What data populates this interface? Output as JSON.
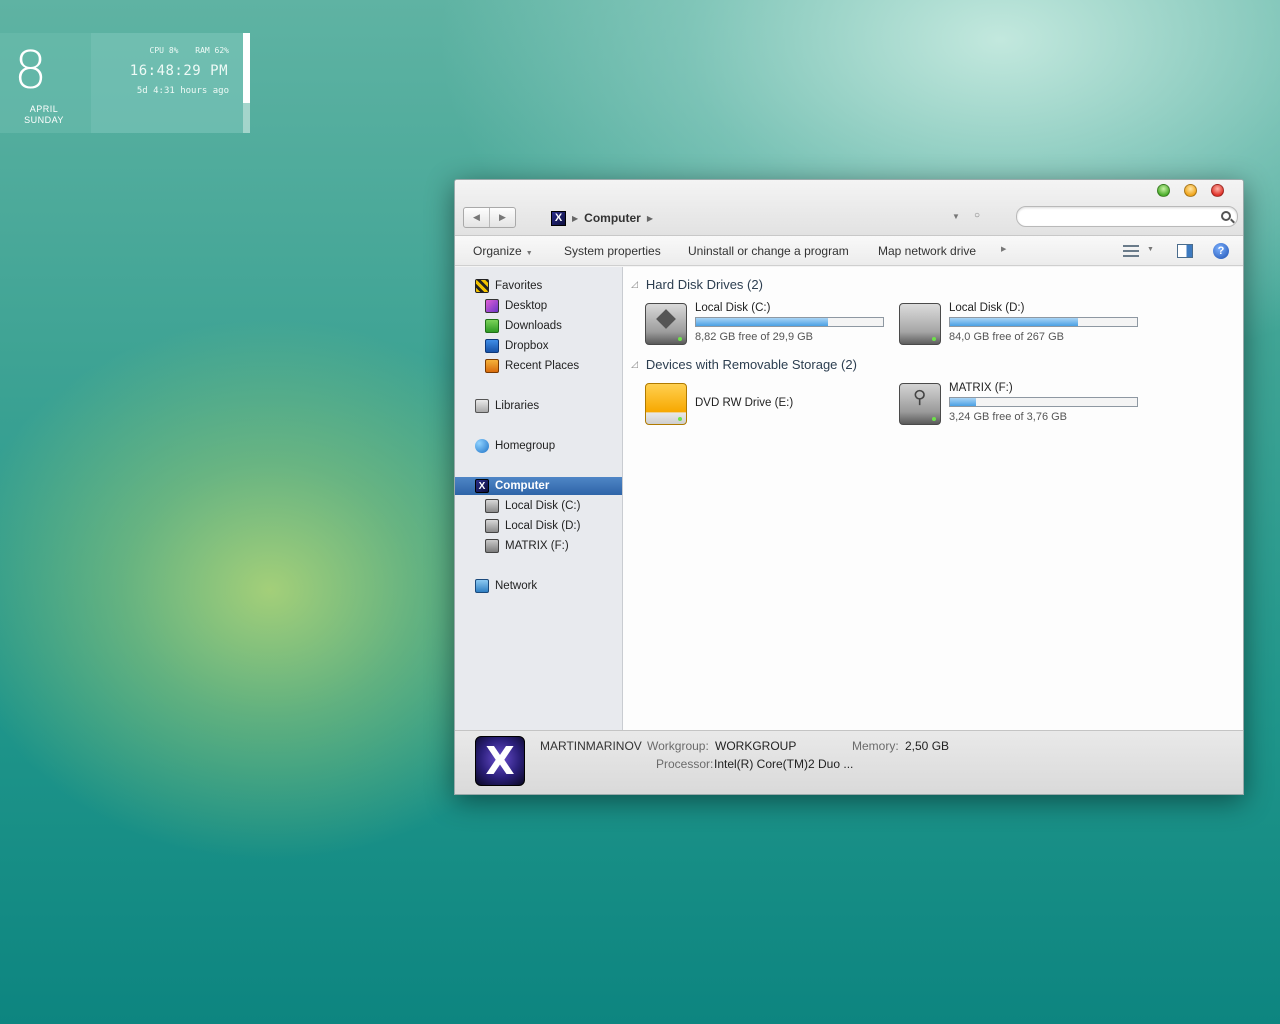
{
  "widget": {
    "day": "8",
    "month": "APRIL",
    "weekday": "SUNDAY",
    "cpu": "CPU 8%",
    "ram": "RAM 62%",
    "time": "16:48:29 PM",
    "uptime": "5d 4:31 hours ago",
    "bar_level": 0.7
  },
  "window": {
    "address": {
      "root": "Computer"
    },
    "search": {
      "placeholder": ""
    },
    "toolbar": {
      "organize": "Organize",
      "system_properties": "System properties",
      "uninstall": "Uninstall or change a program",
      "map_drive": "Map network drive"
    },
    "nav": {
      "favorites": "Favorites",
      "desktop": "Desktop",
      "downloads": "Downloads",
      "dropbox": "Dropbox",
      "recent": "Recent Places",
      "libraries": "Libraries",
      "homegroup": "Homegroup",
      "computer": "Computer",
      "disk_c": "Local Disk (C:)",
      "disk_d": "Local Disk (D:)",
      "matrix": "MATRIX (F:)",
      "network": "Network"
    },
    "groups": {
      "hdd": "Hard Disk Drives (2)",
      "removable": "Devices with Removable Storage (2)"
    },
    "drives": {
      "c": {
        "name": "Local Disk (C:)",
        "free": "8,82 GB free of 29,9 GB",
        "used_fraction": 0.705
      },
      "d": {
        "name": "Local Disk (D:)",
        "free": "84,0 GB free of 267 GB",
        "used_fraction": 0.685
      },
      "e": {
        "name": "DVD RW Drive (E:)"
      },
      "f": {
        "name": "MATRIX (F:)",
        "free": "3,24 GB free of 3,76 GB",
        "used_fraction": 0.138
      }
    },
    "details": {
      "pc_name": "MARTINMARINOV",
      "workgroup_label": "Workgroup:",
      "workgroup": "WORKGROUP",
      "memory_label": "Memory:",
      "memory": "2,50 GB",
      "processor_label": "Processor:",
      "processor": "Intel(R) Core(TM)2 Duo ..."
    }
  }
}
